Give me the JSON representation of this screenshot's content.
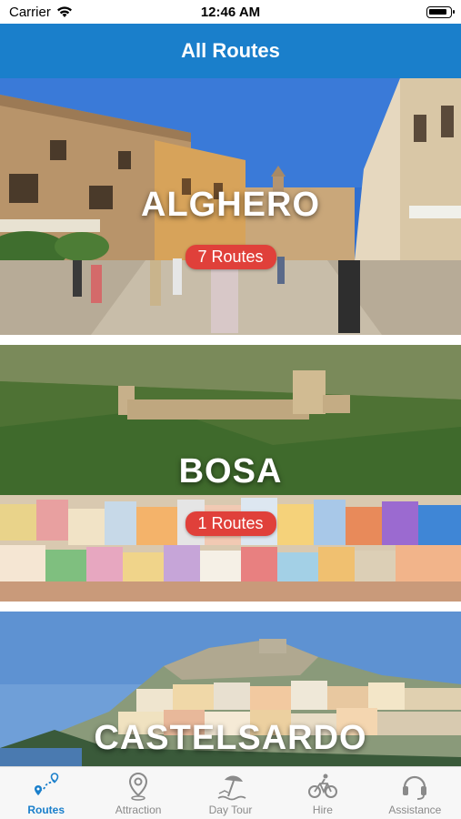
{
  "status_bar": {
    "carrier": "Carrier",
    "time": "12:46 AM"
  },
  "header": {
    "title": "All Routes"
  },
  "routes": [
    {
      "name": "ALGHERO",
      "badge": "7 Routes"
    },
    {
      "name": "BOSA",
      "badge": "1 Routes"
    },
    {
      "name": "CASTELSARDO",
      "badge": ""
    }
  ],
  "tabs": [
    {
      "label": "Routes",
      "icon": "route-map-icon",
      "active": true
    },
    {
      "label": "Attraction",
      "icon": "map-pin-icon",
      "active": false
    },
    {
      "label": "Day Tour",
      "icon": "beach-umbrella-icon",
      "active": false
    },
    {
      "label": "Hire",
      "icon": "bicycle-icon",
      "active": false
    },
    {
      "label": "Assistance",
      "icon": "headset-icon",
      "active": false
    }
  ],
  "colors": {
    "accent": "#1a7fcb",
    "badge": "#e0403a",
    "inactive_tab": "#8a8a8a"
  }
}
